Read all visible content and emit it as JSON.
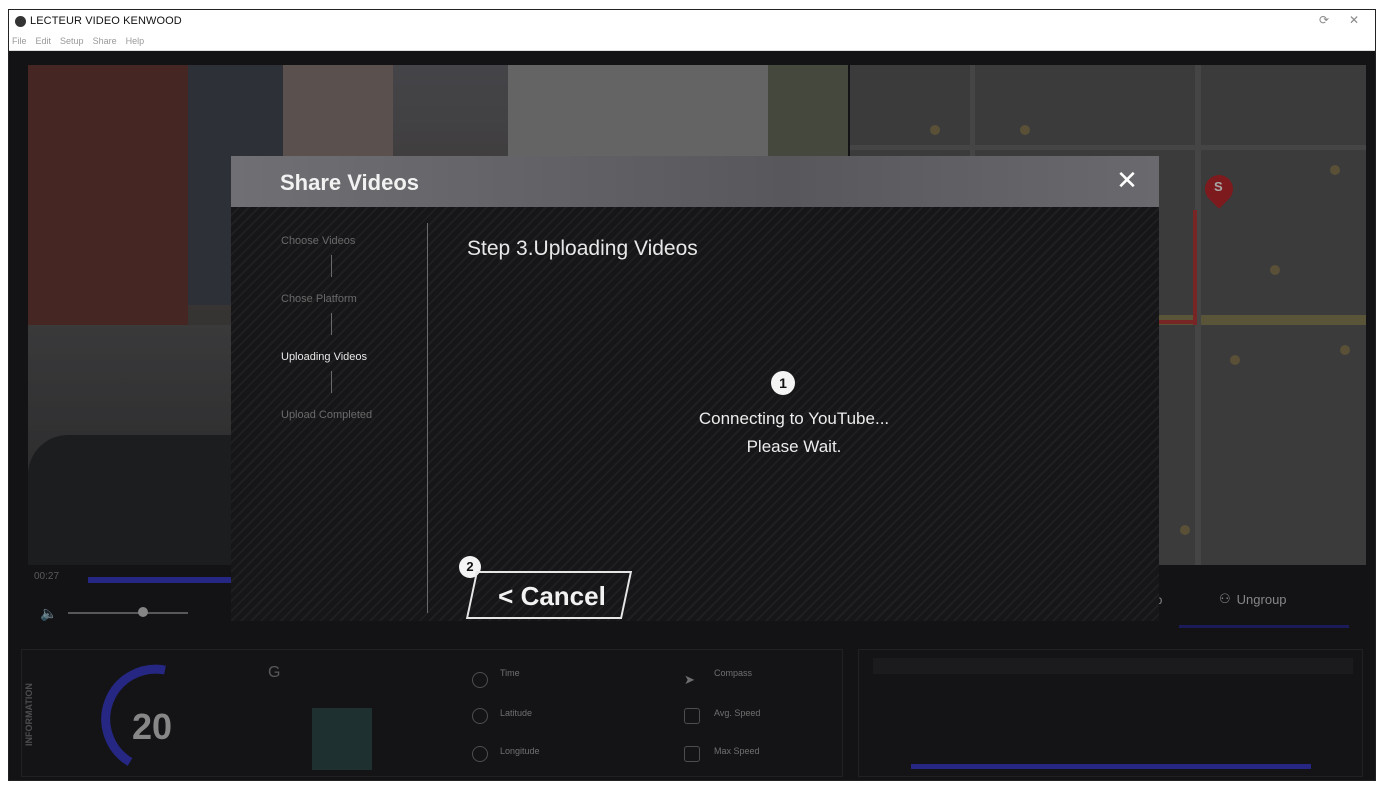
{
  "window": {
    "title": "LECTEUR VIDEO KENWOOD",
    "minimize_glyph": "⟳",
    "close_glyph": "✕"
  },
  "menu": {
    "items": [
      "File",
      "Edit",
      "Setup",
      "Share",
      "Help"
    ]
  },
  "player": {
    "time": "00:27",
    "volume_icon": "speaker-icon"
  },
  "map": {
    "marker_label": "S"
  },
  "group_controls": {
    "group_label": "up",
    "ungroup_label": "Ungroup"
  },
  "info": {
    "panel_label": "INFORMATION",
    "speed": "20",
    "gsensor_label": "G",
    "fields": {
      "time": "Time",
      "latitude": "Latitude",
      "longitude": "Longitude",
      "compass": "Compass",
      "avg_speed": "Avg. Speed",
      "max_speed": "Max Speed"
    }
  },
  "dialog": {
    "title": "Share Videos",
    "close_glyph": "✕",
    "steps": [
      {
        "label": "Choose Videos",
        "active": false
      },
      {
        "label": "Chose Platform",
        "active": false
      },
      {
        "label": "Uploading Videos",
        "active": true
      },
      {
        "label": "Upload Completed",
        "active": false
      }
    ],
    "heading": "Step 3.Uploading Videos",
    "status_line1": "Connecting to YouTube...",
    "status_line2": "Please Wait.",
    "callout1": "1",
    "callout2": "2",
    "cancel_label": "< Cancel"
  }
}
